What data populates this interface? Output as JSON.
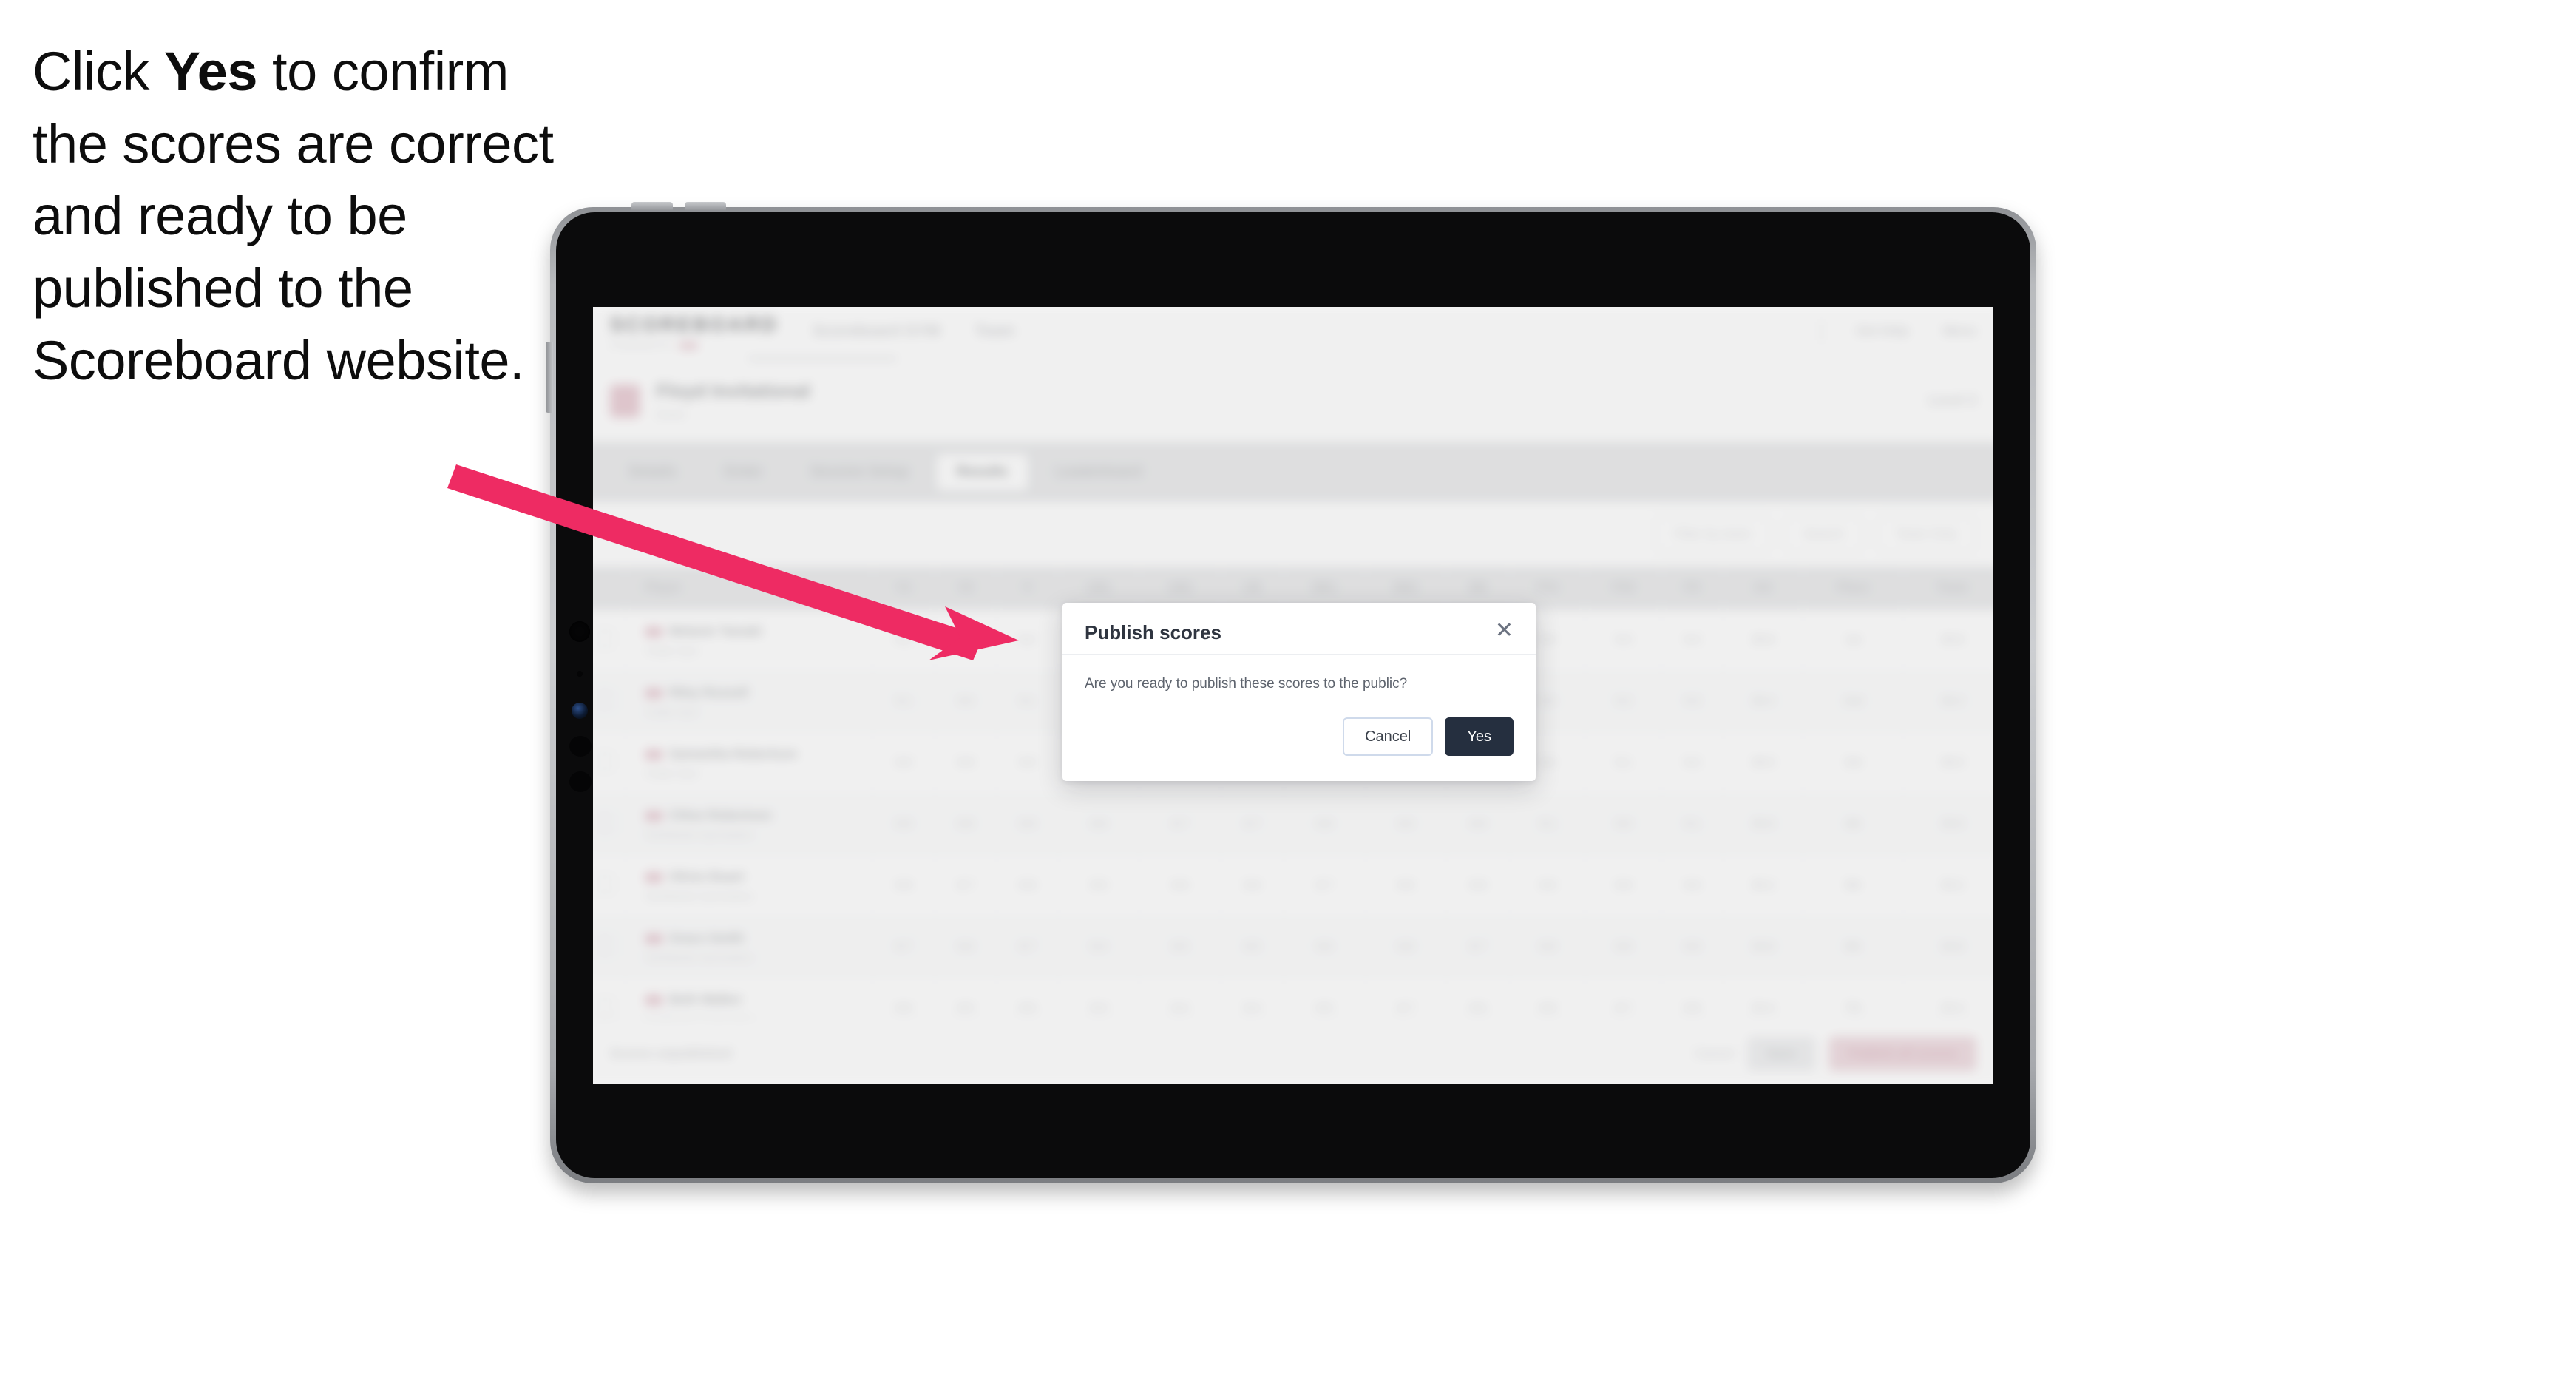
{
  "instruction": {
    "before": "Click ",
    "emphasis": "Yes",
    "after": " to confirm the scores are correct and ready to be published to the Scoreboard website."
  },
  "annotation": {
    "arrow_color": "#EE2B63"
  },
  "app": {
    "brand": {
      "name": "SCOREBOARD",
      "tagline": "POWERED BY"
    },
    "top_nav": [
      "Scoreboard GYM",
      "Team"
    ],
    "top_right": [
      "Get Help",
      "Menu"
    ],
    "competition": {
      "title": "Floyd Invitational",
      "subtitle": "Event",
      "level": "Level 3"
    },
    "tabs": [
      {
        "label": "Details",
        "active": false
      },
      {
        "label": "Order",
        "active": false
      },
      {
        "label": "Session Setup",
        "active": false
      },
      {
        "label": "Results",
        "active": true
      },
      {
        "label": "Leaderboard",
        "active": false
      }
    ],
    "filters": [
      {
        "label": "Filter by team"
      },
      {
        "label": "Search"
      },
      {
        "label": "Team Only"
      }
    ],
    "table": {
      "columns": [
        "Player",
        "V1",
        "V2",
        "V",
        "UB1",
        "UB2",
        "UB",
        "BB1",
        "BB2",
        "BB",
        "FX1",
        "FX2",
        "FX",
        "AA",
        "Place",
        "Team"
      ],
      "rows": [
        {
          "name": "Melanie Tamaki",
          "club": "Cedar Gym",
          "cells": [
            "9.2",
            "9.1",
            "9.2",
            "8.9",
            "9.0",
            "9.0",
            "9.1",
            "9.3",
            "9.2",
            "9.4",
            "9.3",
            "9.4",
            "36.8",
            "1st",
            "36.8"
          ]
        },
        {
          "name": "Riley Russell",
          "club": "Cedar Gym",
          "cells": [
            "9.1",
            "9.0",
            "9.1",
            "8.8",
            "8.9",
            "8.9",
            "9.0",
            "9.2",
            "9.1",
            "9.3",
            "9.2",
            "9.3",
            "36.4",
            "2nd",
            "36.4"
          ]
        },
        {
          "name": "Samantha Robertson",
          "club": "Cedar Gym",
          "cells": [
            "9.0",
            "8.9",
            "9.0",
            "8.7",
            "8.8",
            "8.8",
            "8.9",
            "9.1",
            "9.0",
            "9.2",
            "9.1",
            "9.2",
            "36.0",
            "3rd",
            "36.0"
          ]
        },
        {
          "name": "Chloe Robertson",
          "club": "Northlands Gymnastics",
          "cells": [
            "8.9",
            "8.8",
            "8.9",
            "8.6",
            "8.7",
            "8.7",
            "8.8",
            "9.0",
            "8.9",
            "9.1",
            "9.0",
            "9.1",
            "35.6",
            "4th",
            "35.6"
          ]
        },
        {
          "name": "Olivia Stuart",
          "club": "Northlands Gymnastics",
          "cells": [
            "8.8",
            "8.7",
            "8.8",
            "8.5",
            "8.6",
            "8.6",
            "8.7",
            "8.9",
            "8.8",
            "9.0",
            "8.9",
            "9.0",
            "35.2",
            "5th",
            "35.2"
          ]
        },
        {
          "name": "Grace Smith",
          "club": "Northlands Gymnastics",
          "cells": [
            "8.7",
            "8.6",
            "8.7",
            "8.4",
            "8.5",
            "8.5",
            "8.6",
            "8.8",
            "8.7",
            "8.9",
            "8.8",
            "8.9",
            "34.8",
            "6th",
            "34.8"
          ]
        },
        {
          "name": "Beth Walker",
          "club": "Northlands Gymnastics",
          "cells": [
            "8.6",
            "8.5",
            "8.6",
            "8.3",
            "8.4",
            "8.4",
            "8.5",
            "8.7",
            "8.6",
            "8.8",
            "8.7",
            "8.8",
            "34.4",
            "7th",
            "34.4"
          ]
        }
      ]
    },
    "footer": {
      "note": "Scores unpublished",
      "link": "Cancel",
      "secondary_button": "Save",
      "primary_button": "Publish all scores"
    }
  },
  "modal": {
    "title": "Publish scores",
    "close_icon": "close-icon",
    "message": "Are you ready to publish these scores to the public?",
    "cancel_label": "Cancel",
    "confirm_label": "Yes"
  }
}
